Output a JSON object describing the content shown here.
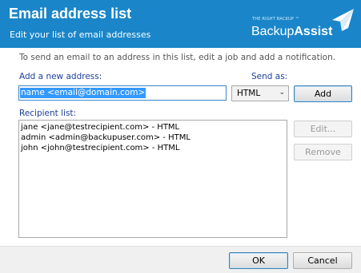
{
  "header": {
    "title": "Email address list",
    "subtitle": "Edit your list of email addresses",
    "logo_tagline": "THE RIGHT BACKUP ™",
    "logo_word1": "Backup",
    "logo_word2": "Assist",
    "background_color": "#1a86c9"
  },
  "instruction": "To send an email to an address in this list, edit a job and add a notification.",
  "add_section": {
    "label": "Add a new address:",
    "input_value": "name <email@domain.com>",
    "send_as_label": "Send as:",
    "send_as_value": "HTML",
    "add_button": "Add"
  },
  "recipients": {
    "label": "Recipient list:",
    "items": [
      "jane <jane@testrecipient.com> - HTML",
      "admin <admin@backupuser.com> - HTML",
      "john <john@testrecipient.com> - HTML"
    ],
    "edit_button": "Edit...",
    "remove_button": "Remove"
  },
  "footer": {
    "ok_button": "OK",
    "cancel_button": "Cancel"
  }
}
